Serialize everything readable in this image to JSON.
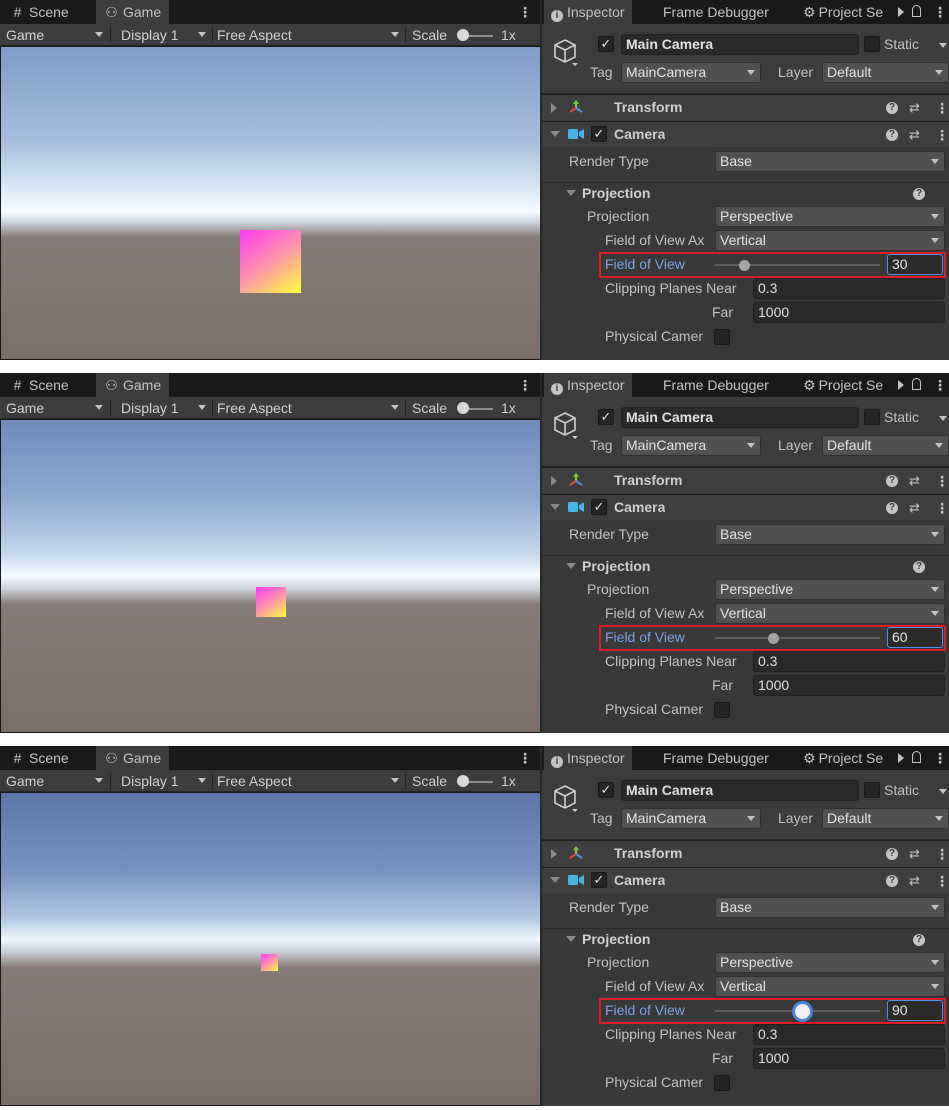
{
  "game_view": {
    "tabs": [
      {
        "label": "Scene",
        "icon": "grid-icon",
        "glyph": "#"
      },
      {
        "label": "Game",
        "icon": "gamepad-icon",
        "glyph": "⚇"
      }
    ],
    "toolbar": {
      "mode": "Game",
      "display": "Display 1",
      "aspect": "Free Aspect",
      "scale_label": "Scale",
      "scale_value": "1x"
    }
  },
  "inspector": {
    "tabs": [
      {
        "label": "Inspector",
        "icon": "info-icon"
      },
      {
        "label": "Frame Debugger"
      },
      {
        "label": "Project Se",
        "icon": "gear-icon"
      }
    ],
    "object": {
      "active_check": "✓",
      "name": "Main Camera",
      "static_label": "Static",
      "tag_label": "Tag",
      "tag": "MainCamera",
      "layer_label": "Layer",
      "layer": "Default"
    },
    "components": {
      "transform": "Transform",
      "camera": "Camera",
      "camera_check": "✓",
      "help_glyph": "?",
      "settings_glyph": "⇄",
      "menu_glyph": "⋮"
    },
    "render_type": {
      "label": "Render Type",
      "value": "Base"
    },
    "projection_section": "Projection",
    "projection": {
      "label": "Projection",
      "value": "Perspective"
    },
    "fov_axis": {
      "label": "Field of View Ax",
      "value": "Vertical"
    },
    "fov_label": "Field of View",
    "clipping": {
      "near_label": "Clipping Planes Near",
      "near": "0.3",
      "far_label": "Far",
      "far": "1000"
    },
    "physical_label": "Physical Camer"
  },
  "colors": {
    "highlight_box": "#dd1c23",
    "fov_label": "#7ba2e7",
    "panel_bg": "#383838",
    "cube_top": "#ff38f2",
    "cube_bottom": "#ffff3a"
  },
  "frames": [
    {
      "fov": "30",
      "fov_fraction": 0.176,
      "cube_size": "large"
    },
    {
      "fov": "60",
      "fov_fraction": 0.353,
      "cube_size": "medium"
    },
    {
      "fov": "90",
      "fov_fraction": 0.529,
      "cube_size": "small"
    }
  ]
}
